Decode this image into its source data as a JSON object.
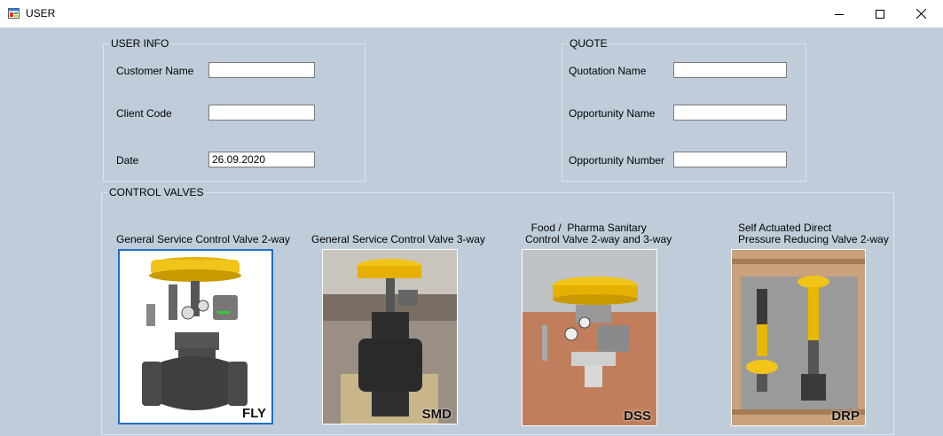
{
  "window": {
    "title": "USER"
  },
  "user_info": {
    "title": "USER INFO",
    "customer_name_label": "Customer Name",
    "customer_name_value": "",
    "client_code_label": "Client Code",
    "client_code_value": "",
    "date_label": "Date",
    "date_value": "26.09.2020"
  },
  "quote": {
    "title": "QUOTE",
    "quotation_name_label": "Quotation Name",
    "quotation_name_value": "",
    "opportunity_name_label": "Opportunity Name",
    "opportunity_name_value": "",
    "opportunity_number_label": "Opportunity Number",
    "opportunity_number_value": ""
  },
  "control_valves": {
    "title": "CONTROL VALVES",
    "items": [
      {
        "caption": "General Service Control Valve 2-way",
        "code": "FLY"
      },
      {
        "caption": "General Service Control Valve 3-way",
        "code": "SMD"
      },
      {
        "caption": "  Food /  Pharma Sanitary\nControl Valve 2-way and 3-way",
        "code": "DSS"
      },
      {
        "caption": "Self Actuated Direct\nPressure Reducing Valve 2-way",
        "code": "DRP"
      }
    ]
  },
  "colors": {
    "background": "#bfcddb",
    "selected_border": "#1f6fc4",
    "actuator_yellow": "#f0c419"
  }
}
